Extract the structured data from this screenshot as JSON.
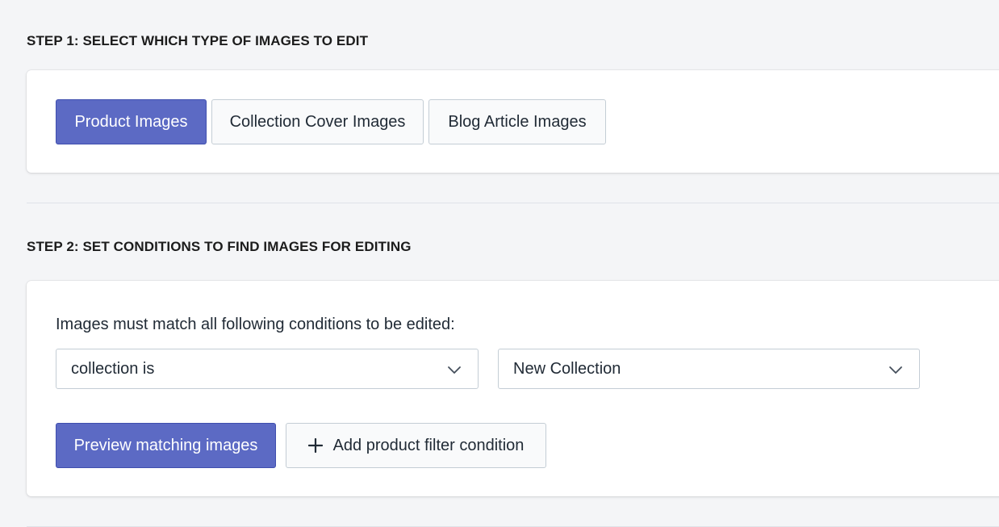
{
  "step1": {
    "heading": "STEP 1: SELECT WHICH TYPE OF IMAGES TO EDIT",
    "options": [
      {
        "label": "Product Images",
        "selected": true
      },
      {
        "label": "Collection Cover Images",
        "selected": false
      },
      {
        "label": "Blog Article Images",
        "selected": false
      }
    ]
  },
  "step2": {
    "heading": "STEP 2: SET CONDITIONS TO FIND IMAGES FOR EDITING",
    "conditions_label": "Images must match all following conditions to be edited:",
    "condition_select": {
      "value": "collection is",
      "icon": "chevron-down-icon"
    },
    "value_select": {
      "value": "New Collection",
      "icon": "chevron-down-icon"
    },
    "preview_button": "Preview matching images",
    "add_condition_button": {
      "label": "Add product filter condition",
      "icon": "plus-icon"
    }
  },
  "colors": {
    "primary": "#5c6ac4",
    "background": "#f4f5f7",
    "card": "#ffffff",
    "border": "#c4cdd5"
  }
}
